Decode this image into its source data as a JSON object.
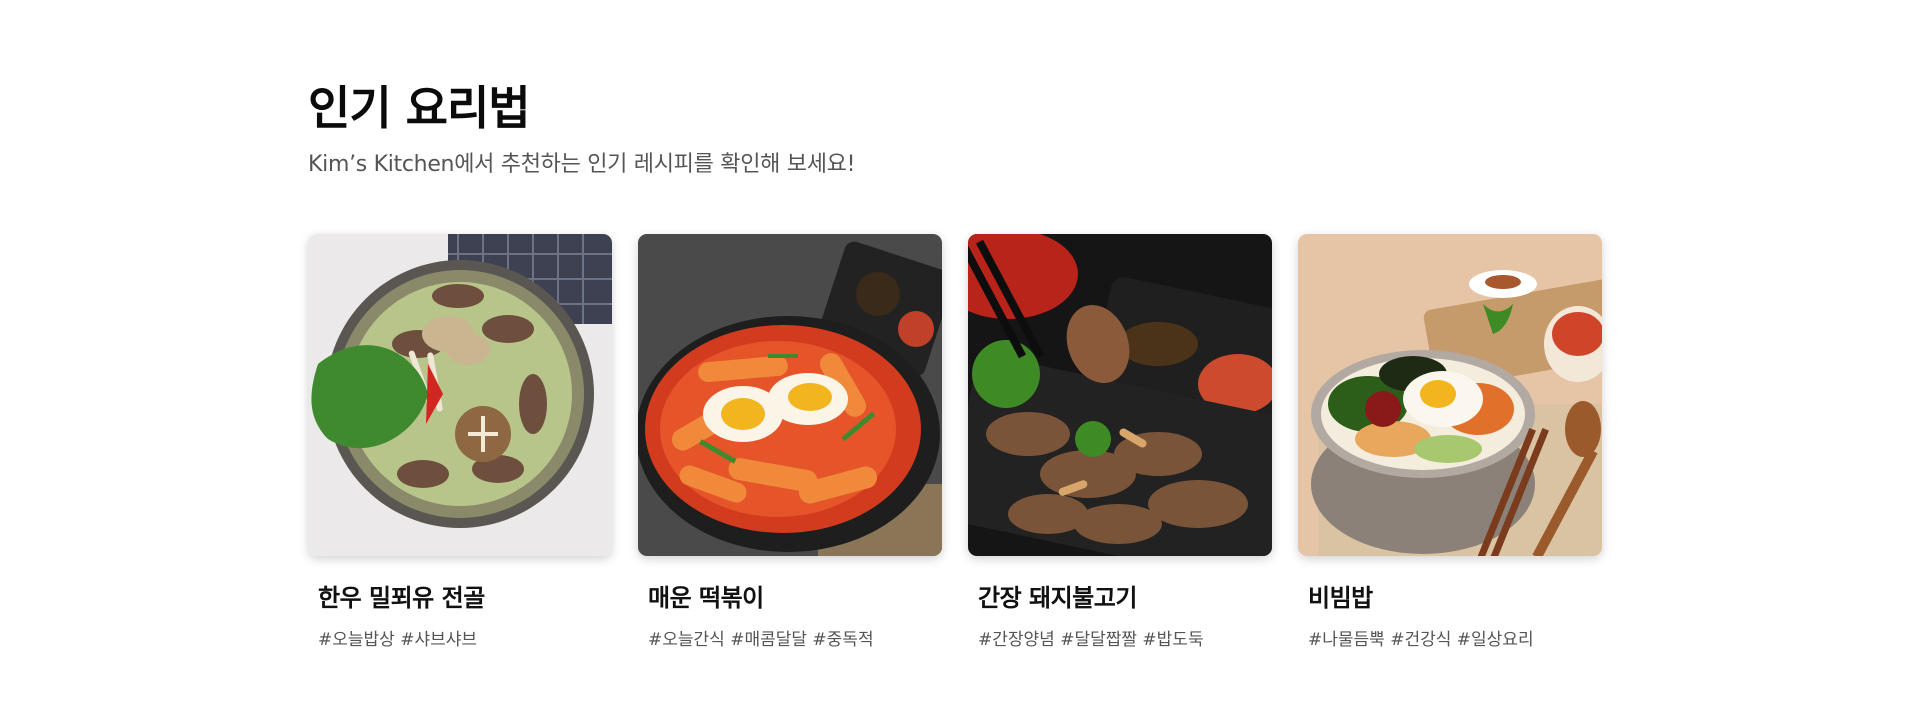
{
  "section": {
    "title": "인기 요리법",
    "subtitle": "Kim’s Kitchen에서 추천하는 인기 레시피를 확인해 보세요!"
  },
  "recipes": [
    {
      "title": "한우 밀푀유 전골",
      "tags": "#오늘밥상 #샤브샤브",
      "image_icon": "hotpot-photo"
    },
    {
      "title": "매운 떡볶이",
      "tags": "#오늘간식 #매콤달달 #중독적",
      "image_icon": "tteokbokki-photo"
    },
    {
      "title": "간장 돼지불고기",
      "tags": "#간장양념 #달달짭짤 #밥도둑",
      "image_icon": "bulgogi-photo"
    },
    {
      "title": "비빔밥",
      "tags": "#나물듬뿍 #건강식 #일상요리",
      "image_icon": "bibimbap-photo"
    }
  ]
}
